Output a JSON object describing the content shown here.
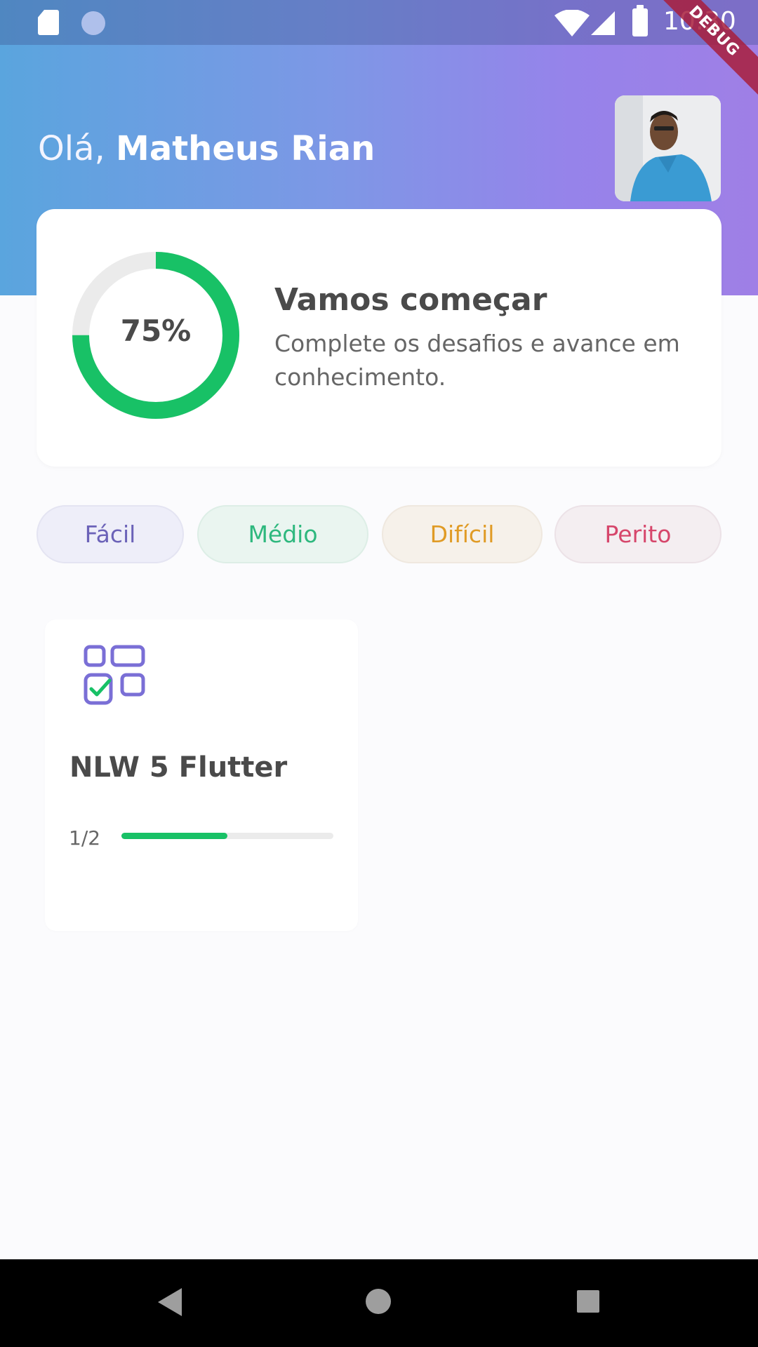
{
  "status_bar": {
    "time": "10:30",
    "debug_label": "DEBUG",
    "icons": [
      "sd-card-icon",
      "sync-icon",
      "wifi-icon",
      "cell-signal-icon",
      "battery-icon"
    ]
  },
  "header": {
    "greeting_prefix": "Olá, ",
    "user_name": "Matheus Rian",
    "avatar_icon": "user-avatar"
  },
  "score_card": {
    "percent_label": "75%",
    "percent_value": 0.75,
    "title": "Vamos começar",
    "subtitle": "Complete os desafios e avance em conhecimento."
  },
  "levels": [
    {
      "label": "Fácil",
      "color": "#6B62B8"
    },
    {
      "label": "Médio",
      "color": "#2EB87E"
    },
    {
      "label": "Difícil",
      "color": "#E09B25"
    },
    {
      "label": "Perito",
      "color": "#D6466B"
    }
  ],
  "quizzes": [
    {
      "icon": "quiz-grid-icon",
      "title": "NLW 5 Flutter",
      "progress_label": "1/2",
      "progress_value": 0.5
    }
  ],
  "colors": {
    "accent_green": "#18C166",
    "primary_purple": "#6B62B8",
    "text_dark": "#4A4A4A"
  },
  "nav_bar": {
    "icons": [
      "back-icon",
      "home-icon",
      "recents-icon"
    ]
  }
}
